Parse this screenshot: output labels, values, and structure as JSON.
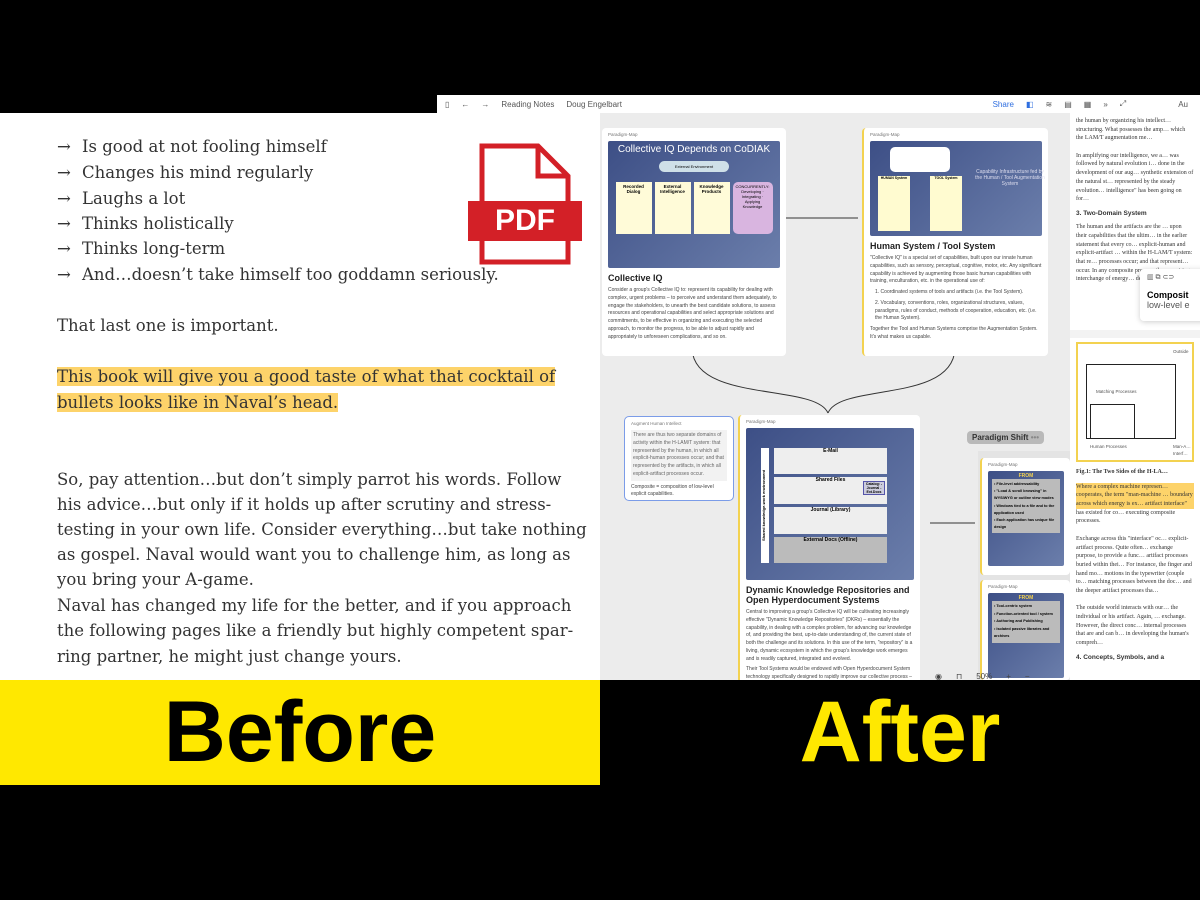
{
  "before": {
    "bullets": [
      "Is good at not fooling himself",
      "Changes his mind regularly",
      "Laughs a lot",
      "Thinks holistically",
      "Thinks long-term",
      "And…doesn’t take himself too goddamn seriously."
    ],
    "bullet_icon": "arrow-right-icon",
    "p1": "That last one is important.",
    "p2": [
      "This book will give you a good taste of what that cocktail of",
      "bullets looks like in Naval’s head."
    ],
    "p3": [
      "So, pay attention…but don’t simply parrot his words. Follow",
      "his advice…but only if it holds up after scrutiny and stress-",
      "testing in your own life. Consider everything…but take nothing",
      "as gospel. Naval would want you to challenge him, as long as",
      "you bring your A-game."
    ],
    "p4": [
      "Naval has changed my life for the better, and if you approach",
      "the following pages like a friendly but highly competent spar-",
      "ring partner, he might just change yours."
    ],
    "pdf_label": "PDF",
    "label": "Before",
    "highlight_color": "#fdd36a"
  },
  "after": {
    "label": "After",
    "toolbar": {
      "breadcrumb": [
        "Reading Notes",
        "Doug Engelbart"
      ],
      "share": "Share",
      "right_label": "Au"
    },
    "cards": {
      "collective": {
        "tag": "Paradigm-Map",
        "img_title": "Collective IQ Depends on CoDIAK",
        "img_labels": [
          "External Environment",
          "Recorded Dialog",
          "External Intelligence",
          "Knowledge Products",
          "CONCURRENTLY: Developing · Integrating · Applying Knowledge"
        ],
        "title": "Collective IQ",
        "body": "Consider a group's Collective IQ to: represent its capability for dealing with complex, urgent problems – to perceive and understand them adequately, to engage the stakeholders, to unearth the best candidate solutions, to assess resources and operational capabilities and select appropriate solutions and commitments, to be effective in organizing and executing the selected approach, to monitor the progress, to be able to adjust rapidly and appropriately to unforeseen complications, and so on."
      },
      "human": {
        "tag": "Paradigm-Map",
        "img_labels": [
          "HUMAN System",
          "TOOL System"
        ],
        "img_caption": "Capability Infrastructure fed by the Human / Tool Augmentation System",
        "title": "Human System / Tool System",
        "body": "\"Collective IQ\" is a special set of capabilities, built upon our innate human capabilities, such as sensory, perceptual, cognitive, motor, etc. Any significant capability is achieved by augmenting those basic human capabilities with training, enculturation, etc. in the operational use of:",
        "list": [
          "1. Coordinated systems of tools and artifacts (i.e. the Tool System).",
          "2. Vocabulary, conventions, roles, organizational structures, values, paradigms, rules of conduct, methods of cooperation, education, etc. (i.e. the Human System)."
        ],
        "footer": "Together the Tool and Human Systems comprise the Augmentation System. It's what makes us capable."
      },
      "augment": {
        "tag": "Augment Human Intellect",
        "quote": "There are thus two separate domains of activity within the H-LAM/T system: that represented by the human, in which all explicit-human processes occur; and that represented by the artifacts, in which all explicit-artifact processes occur.",
        "note": "Composite = composition of low-level explicit capabilities."
      },
      "dkr": {
        "tag": "Paradigm-Map",
        "img_labels": [
          "Shared knowledge-work environment",
          "E-Mail",
          "Shared Files",
          "Catalog: -Journal -Ext.Docs",
          "Journal (Library)",
          "External Docs (Offline)"
        ],
        "title": "Dynamic Knowledge Repositories and Open Hyperdocument Systems",
        "body": "Central to improving a group's Collective IQ will be cultivating increasingly effective \"Dynamic Knowledge Repositories\" (DKRs) – essentially the capability, in dealing with a complex problem, for advancing our knowledge of, and providing the best, up-to-date understanding of, the current state of both the challenge and its solutions. In this use of the term, \"repository\" is a living, dynamic ecosystem in which the group's knowledge work emerges and is readily captured, integrated and evolved.",
        "body2": "Their Tool Systems would be endowed with Open Hyperdocument System technology specifically designed to rapidly improve our collective process –"
      },
      "shift": {
        "label": "Paradigm Shift",
        "more": "•••",
        "cards": [
          {
            "tag": "Paradigm-Map",
            "head": "FROM",
            "items": [
              "• File-level addressability",
              "• \"Load & scroll browsing\" in WYSIWYG or outline view modes",
              "• Windows tied to a file and to the application used",
              "• Each application has unique file design"
            ]
          },
          {
            "tag": "Paradigm-Map",
            "head": "FROM",
            "items": [
              "• Tool-centric system",
              "• Function-oriented tool / system",
              "• Authoring and Publishing",
              "• Isolated passive libraries and archives"
            ]
          }
        ]
      }
    },
    "doc": {
      "p1": "the human by organizing his intellect… structuring. What possesses the amp… which the LAM/T augmentation me…",
      "p2": "In amplifying our intelligence, we a… was followed by natural evolution i… done in the development of our aug… synthetic extension of the natural st… represented by the steady evolution… intelligence\" has been going on for…",
      "h3": "3. Two-Domain System",
      "p3": "The human and the artifacts are the … upon their capabilities that the ultim… in the earlier statement that every co… explicit-human and explicit-artifact … within the H-LAM/T system: that re… processes occur; and that represent… occur. In any composite process, th… requiring interchange of energy… depicts this",
      "popup": [
        "Composit",
        "low-level e"
      ],
      "fig_labels": [
        "Outside",
        "Matching Processes",
        "Human Processes",
        "Man-A… Interf…"
      ],
      "fig_caption": "Fig.1: The Two Sides of the H-LA…",
      "p4": "Where a complex machine represen… cooperates, the term \"man-machine … boundary across which energy is ex… artifact interface\" has existed for co… executing composite processes.",
      "p5": "Exchange across this \"interface\" oc… explicit-artifact process. Quite often… exchange purpose, to provide a func… artifact processes buried within thei… For instance, the finger and hand mo… motions in the typewriter (couple to… matching processes between the doc… and the deeper artifact processes tha…",
      "p6": "The outside world interacts with our… the individual or his artifact. Again, … exchange. However, the direct conc… internal processes that are and can b… in developing the human's compreh…",
      "h4": "4. Concepts, Symbols, and a"
    },
    "zoom": "50%"
  }
}
